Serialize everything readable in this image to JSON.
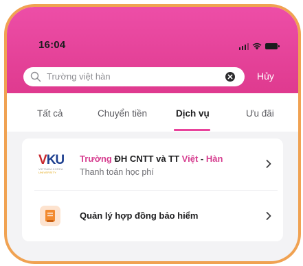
{
  "status_bar": {
    "time": "16:04",
    "icons": [
      "signal-icon",
      "wifi-icon",
      "battery-icon"
    ]
  },
  "search": {
    "value": "Trường việt hàn",
    "placeholder": "Trường việt hàn",
    "cancel_label": "Hủy"
  },
  "tabs": [
    {
      "label": "Tất cả",
      "active": false
    },
    {
      "label": "Chuyển tiền",
      "active": false
    },
    {
      "label": "Dịch vụ",
      "active": true
    },
    {
      "label": "Ưu đãi",
      "active": false
    }
  ],
  "results": {
    "item1": {
      "logo_text_v": "V",
      "logo_text_ku": "KU",
      "logo_subtext_a": "VIETNAM-KOREA ",
      "logo_subtext_b": "UNIVERSITY",
      "title_prefix": "Trường",
      "title_middle": " ĐH CNTT và TT ",
      "title_hl2": "Việt",
      "title_sep": " - ",
      "title_hl3": "Hàn",
      "subtitle": "Thanh toán học phí",
      "icon": "vku-logo"
    },
    "item2": {
      "title": "Quản lý hợp đồng bảo hiểm",
      "icon": "insurance-document-icon"
    }
  },
  "colors": {
    "header_pink": "#e8429b",
    "accent": "#d63d8f",
    "frame_orange": "#f0a252"
  }
}
